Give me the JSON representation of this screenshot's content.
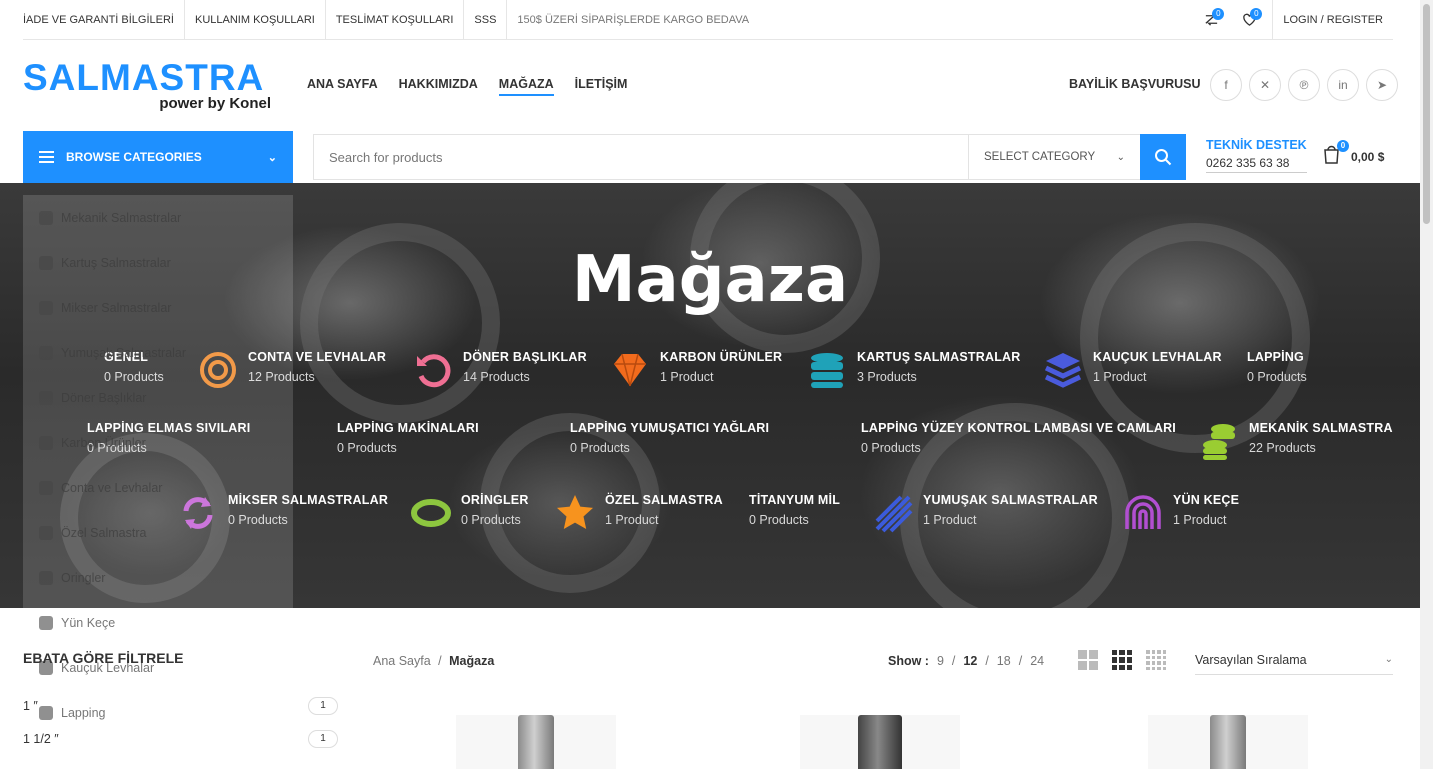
{
  "topbar": {
    "links": [
      "İADE VE GARANTİ BİLGİLERİ",
      "KULLANIM KOŞULLARI",
      "TESLİMAT KOŞULLARI",
      "SSS"
    ],
    "promo": "150$ ÜZERİ SİPARİŞLERDE KARGO BEDAVA",
    "compare_count": "0",
    "wishlist_count": "0",
    "login": "LOGIN / REGISTER"
  },
  "logo": {
    "main": "SALMASTRA",
    "sub": "power by Konel"
  },
  "nav": {
    "items": [
      "ANA SAYFA",
      "HAKKIMIZDA",
      "MAĞAZA",
      "İLETİŞİM"
    ],
    "active": "MAĞAZA"
  },
  "header": {
    "dealer": "BAYİLİK BAŞVURUSU",
    "social": [
      "facebook-icon",
      "x-icon",
      "pinterest-icon",
      "linkedin-icon",
      "telegram-icon"
    ]
  },
  "browse": {
    "label": "BROWSE CATEGORIES"
  },
  "search": {
    "placeholder": "Search for products",
    "category": "SELECT CATEGORY"
  },
  "support": {
    "title": "TEKNİK DESTEK",
    "phone": "0262 335 63 38"
  },
  "cart": {
    "count": "0",
    "total": "0,00 $"
  },
  "hero": {
    "title": "Mağaza"
  },
  "categories": [
    {
      "name": "GENEL",
      "count": "0 Products",
      "icon": "none"
    },
    {
      "name": "CONTA VE LEVHALAR",
      "count": "12 Products",
      "icon": "target-icon",
      "color": "#f0892a"
    },
    {
      "name": "DÖNER BAŞLIKLAR",
      "count": "14 Products",
      "icon": "rotate-icon",
      "color": "#ef6f93"
    },
    {
      "name": "KARBON ÜRÜNLER",
      "count": "1 Product",
      "icon": "gem-icon",
      "color": "#f26b1d"
    },
    {
      "name": "KARTUŞ SALMASTRALAR",
      "count": "3 Products",
      "icon": "database-icon",
      "color": "#1fa2b8"
    },
    {
      "name": "KAUÇUK LEVHALAR",
      "count": "1 Product",
      "icon": "layers-icon",
      "color": "#4a5bdc"
    },
    {
      "name": "LAPPİNG",
      "count": "0 Products",
      "icon": "none"
    },
    {
      "name": "LAPPİNG ELMAS SIVILARI",
      "count": "0 Products",
      "icon": "none"
    },
    {
      "name": "LAPPİNG MAKİNALARI",
      "count": "0 Products",
      "icon": "none"
    },
    {
      "name": "LAPPİNG YUMUŞATICI YAĞLARI",
      "count": "0 Products",
      "icon": "none"
    },
    {
      "name": "LAPPİNG YÜZEY KONTROL LAMBASI VE CAMLARI",
      "count": "0 Products",
      "icon": "none"
    },
    {
      "name": "MEKANİK SALMASTRA",
      "count": "22 Products",
      "icon": "coins-icon",
      "color": "#9acd32"
    },
    {
      "name": "MİKSER SALMASTRALAR",
      "count": "0 Products",
      "icon": "sync-icon",
      "color": "#c45fd6"
    },
    {
      "name": "ORİNGLER",
      "count": "0 Products",
      "icon": "oring-icon",
      "color": "#8dc63f"
    },
    {
      "name": "ÖZEL SALMASTRA",
      "count": "1 Product",
      "icon": "star-icon",
      "color": "#f7931e"
    },
    {
      "name": "TİTANYUM MİL",
      "count": "0 Products",
      "icon": "none"
    },
    {
      "name": "YUMUŞAK SALMASTRALAR",
      "count": "1 Product",
      "icon": "wave-icon",
      "color": "#3b5bdb"
    },
    {
      "name": "YÜN KEÇE",
      "count": "1 Product",
      "icon": "arch-icon",
      "color": "#b24fd1"
    }
  ],
  "dropdown": [
    "Mekanik Salmastralar",
    "Kartuş Salmastralar",
    "Mikser Salmastralar",
    "Yumuşak Salmastralar",
    "Döner Başlıklar",
    "Karbon Ürünler",
    "Conta ve Levhalar",
    "Özel Salmastra",
    "Oringler",
    "Yün Keçe",
    "Kauçuk Levhalar",
    "Lapping"
  ],
  "filter": {
    "title": "EBATA GÖRE FİLTRELE",
    "items": [
      {
        "label": "1 ″",
        "count": "1"
      },
      {
        "label": "1 1/2 ″",
        "count": "1"
      }
    ]
  },
  "breadcrumb": {
    "home": "Ana Sayfa",
    "sep": "/",
    "current": "Mağaza"
  },
  "show": {
    "label": "Show :",
    "options": [
      "9",
      "12",
      "18",
      "24"
    ],
    "selected": "12"
  },
  "sort": {
    "value": "Varsayılan Sıralama"
  }
}
